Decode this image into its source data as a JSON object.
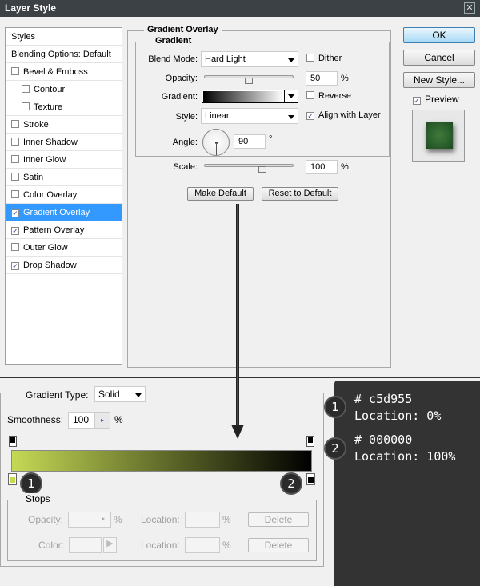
{
  "window": {
    "title": "Layer Style",
    "close": "✕"
  },
  "sidebar": {
    "items": [
      {
        "label": "Styles",
        "checkbox": false
      },
      {
        "label": "Blending Options: Default",
        "checkbox": false
      },
      {
        "label": "Bevel & Emboss",
        "checkbox": true,
        "checked": false
      },
      {
        "label": "Contour",
        "checkbox": true,
        "checked": false,
        "sub": true
      },
      {
        "label": "Texture",
        "checkbox": true,
        "checked": false,
        "sub": true
      },
      {
        "label": "Stroke",
        "checkbox": true,
        "checked": false
      },
      {
        "label": "Inner Shadow",
        "checkbox": true,
        "checked": false
      },
      {
        "label": "Inner Glow",
        "checkbox": true,
        "checked": false
      },
      {
        "label": "Satin",
        "checkbox": true,
        "checked": false
      },
      {
        "label": "Color Overlay",
        "checkbox": true,
        "checked": false
      },
      {
        "label": "Gradient Overlay",
        "checkbox": true,
        "checked": true,
        "selected": true
      },
      {
        "label": "Pattern Overlay",
        "checkbox": true,
        "checked": true
      },
      {
        "label": "Outer Glow",
        "checkbox": true,
        "checked": false
      },
      {
        "label": "Drop Shadow",
        "checkbox": true,
        "checked": true
      }
    ]
  },
  "overlay": {
    "section": "Gradient Overlay",
    "group": "Gradient",
    "blend_mode_label": "Blend Mode:",
    "blend_mode": "Hard Light",
    "dither": "Dither",
    "opacity_label": "Opacity:",
    "opacity": "50",
    "opacity_unit": "%",
    "opacity_value": 50,
    "gradient_label": "Gradient:",
    "reverse": "Reverse",
    "style_label": "Style:",
    "style": "Linear",
    "align": "Align with Layer",
    "angle_label": "Angle:",
    "angle": "90",
    "angle_unit": "°",
    "scale_label": "Scale:",
    "scale": "100",
    "scale_unit": "%",
    "scale_value": 100,
    "make_default": "Make Default",
    "reset_default": "Reset to Default"
  },
  "buttons": {
    "ok": "OK",
    "cancel": "Cancel",
    "new_style": "New Style...",
    "preview": "Preview"
  },
  "editor": {
    "type_label": "Gradient Type:",
    "type": "Solid",
    "smoothness_label": "Smoothness:",
    "smoothness": "100",
    "smoothness_unit": "%",
    "stops_label": "Stops",
    "opacity_label": "Opacity:",
    "color_label": "Color:",
    "location_label": "Location:",
    "pct": "%",
    "delete": "Delete",
    "stop1_color": "#c5d955",
    "stop2_color": "#000000"
  },
  "notes": [
    {
      "n": "1",
      "hex": "# c5d955",
      "loc": "Location: 0%"
    },
    {
      "n": "2",
      "hex": "# 000000",
      "loc": "Location: 100%"
    }
  ]
}
